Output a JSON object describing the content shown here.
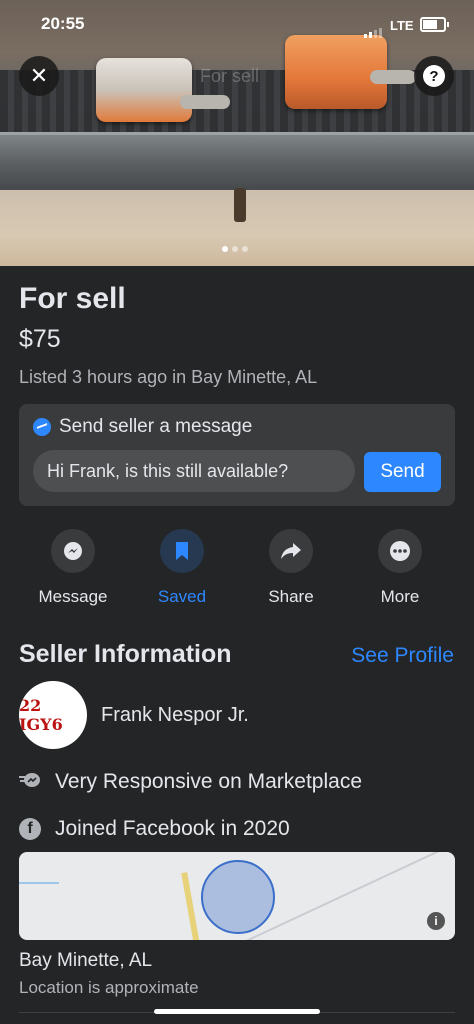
{
  "status_bar": {
    "time": "20:55",
    "network": "LTE"
  },
  "photo": {
    "watermark_text": "For sell",
    "page_dots": {
      "count": 3,
      "active_index": 0
    },
    "close_icon": "close-icon",
    "help_icon": "question-icon"
  },
  "listing": {
    "title": "For sell",
    "price": "$75",
    "listed": "Listed 3 hours ago in Bay Minette, AL"
  },
  "message_card": {
    "heading": "Send seller a message",
    "input_value": "Hi Frank, is this still available?",
    "send_label": "Send"
  },
  "actions": [
    {
      "label": "Message",
      "icon": "messenger-icon"
    },
    {
      "label": "Saved",
      "icon": "bookmark-icon"
    },
    {
      "label": "Share",
      "icon": "share-icon"
    },
    {
      "label": "More",
      "icon": "more-icon"
    }
  ],
  "seller": {
    "heading": "Seller Information",
    "see_profile": "See Profile",
    "name": "Frank Nespor Jr.",
    "avatar_text": "22 IGY6",
    "responsive": "Very Responsive on Marketplace",
    "joined": "Joined Facebook in 2020"
  },
  "location": {
    "city": "Bay Minette, AL",
    "note": "Location is approximate"
  },
  "colors": {
    "background": "#242526",
    "card": "#3a3b3c",
    "accent": "#2d88ff",
    "text_primary": "#e4e6eb",
    "text_secondary": "#b0b3b8"
  }
}
